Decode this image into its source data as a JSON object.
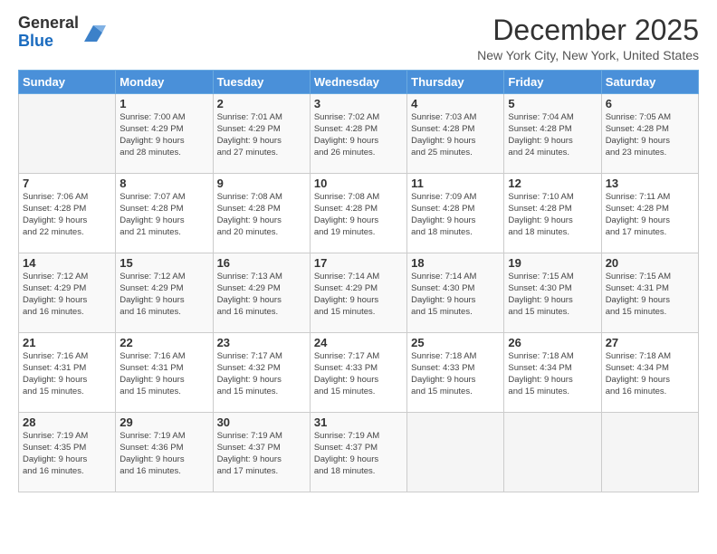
{
  "logo": {
    "general": "General",
    "blue": "Blue"
  },
  "title": "December 2025",
  "subtitle": "New York City, New York, United States",
  "days_header": [
    "Sunday",
    "Monday",
    "Tuesday",
    "Wednesday",
    "Thursday",
    "Friday",
    "Saturday"
  ],
  "weeks": [
    [
      {
        "day": "",
        "info": ""
      },
      {
        "day": "1",
        "info": "Sunrise: 7:00 AM\nSunset: 4:29 PM\nDaylight: 9 hours\nand 28 minutes."
      },
      {
        "day": "2",
        "info": "Sunrise: 7:01 AM\nSunset: 4:29 PM\nDaylight: 9 hours\nand 27 minutes."
      },
      {
        "day": "3",
        "info": "Sunrise: 7:02 AM\nSunset: 4:28 PM\nDaylight: 9 hours\nand 26 minutes."
      },
      {
        "day": "4",
        "info": "Sunrise: 7:03 AM\nSunset: 4:28 PM\nDaylight: 9 hours\nand 25 minutes."
      },
      {
        "day": "5",
        "info": "Sunrise: 7:04 AM\nSunset: 4:28 PM\nDaylight: 9 hours\nand 24 minutes."
      },
      {
        "day": "6",
        "info": "Sunrise: 7:05 AM\nSunset: 4:28 PM\nDaylight: 9 hours\nand 23 minutes."
      }
    ],
    [
      {
        "day": "7",
        "info": "Sunrise: 7:06 AM\nSunset: 4:28 PM\nDaylight: 9 hours\nand 22 minutes."
      },
      {
        "day": "8",
        "info": "Sunrise: 7:07 AM\nSunset: 4:28 PM\nDaylight: 9 hours\nand 21 minutes."
      },
      {
        "day": "9",
        "info": "Sunrise: 7:08 AM\nSunset: 4:28 PM\nDaylight: 9 hours\nand 20 minutes."
      },
      {
        "day": "10",
        "info": "Sunrise: 7:08 AM\nSunset: 4:28 PM\nDaylight: 9 hours\nand 19 minutes."
      },
      {
        "day": "11",
        "info": "Sunrise: 7:09 AM\nSunset: 4:28 PM\nDaylight: 9 hours\nand 18 minutes."
      },
      {
        "day": "12",
        "info": "Sunrise: 7:10 AM\nSunset: 4:28 PM\nDaylight: 9 hours\nand 18 minutes."
      },
      {
        "day": "13",
        "info": "Sunrise: 7:11 AM\nSunset: 4:28 PM\nDaylight: 9 hours\nand 17 minutes."
      }
    ],
    [
      {
        "day": "14",
        "info": "Sunrise: 7:12 AM\nSunset: 4:29 PM\nDaylight: 9 hours\nand 16 minutes."
      },
      {
        "day": "15",
        "info": "Sunrise: 7:12 AM\nSunset: 4:29 PM\nDaylight: 9 hours\nand 16 minutes."
      },
      {
        "day": "16",
        "info": "Sunrise: 7:13 AM\nSunset: 4:29 PM\nDaylight: 9 hours\nand 16 minutes."
      },
      {
        "day": "17",
        "info": "Sunrise: 7:14 AM\nSunset: 4:29 PM\nDaylight: 9 hours\nand 15 minutes."
      },
      {
        "day": "18",
        "info": "Sunrise: 7:14 AM\nSunset: 4:30 PM\nDaylight: 9 hours\nand 15 minutes."
      },
      {
        "day": "19",
        "info": "Sunrise: 7:15 AM\nSunset: 4:30 PM\nDaylight: 9 hours\nand 15 minutes."
      },
      {
        "day": "20",
        "info": "Sunrise: 7:15 AM\nSunset: 4:31 PM\nDaylight: 9 hours\nand 15 minutes."
      }
    ],
    [
      {
        "day": "21",
        "info": "Sunrise: 7:16 AM\nSunset: 4:31 PM\nDaylight: 9 hours\nand 15 minutes."
      },
      {
        "day": "22",
        "info": "Sunrise: 7:16 AM\nSunset: 4:31 PM\nDaylight: 9 hours\nand 15 minutes."
      },
      {
        "day": "23",
        "info": "Sunrise: 7:17 AM\nSunset: 4:32 PM\nDaylight: 9 hours\nand 15 minutes."
      },
      {
        "day": "24",
        "info": "Sunrise: 7:17 AM\nSunset: 4:33 PM\nDaylight: 9 hours\nand 15 minutes."
      },
      {
        "day": "25",
        "info": "Sunrise: 7:18 AM\nSunset: 4:33 PM\nDaylight: 9 hours\nand 15 minutes."
      },
      {
        "day": "26",
        "info": "Sunrise: 7:18 AM\nSunset: 4:34 PM\nDaylight: 9 hours\nand 15 minutes."
      },
      {
        "day": "27",
        "info": "Sunrise: 7:18 AM\nSunset: 4:34 PM\nDaylight: 9 hours\nand 16 minutes."
      }
    ],
    [
      {
        "day": "28",
        "info": "Sunrise: 7:19 AM\nSunset: 4:35 PM\nDaylight: 9 hours\nand 16 minutes."
      },
      {
        "day": "29",
        "info": "Sunrise: 7:19 AM\nSunset: 4:36 PM\nDaylight: 9 hours\nand 16 minutes."
      },
      {
        "day": "30",
        "info": "Sunrise: 7:19 AM\nSunset: 4:37 PM\nDaylight: 9 hours\nand 17 minutes."
      },
      {
        "day": "31",
        "info": "Sunrise: 7:19 AM\nSunset: 4:37 PM\nDaylight: 9 hours\nand 18 minutes."
      },
      {
        "day": "",
        "info": ""
      },
      {
        "day": "",
        "info": ""
      },
      {
        "day": "",
        "info": ""
      }
    ]
  ]
}
